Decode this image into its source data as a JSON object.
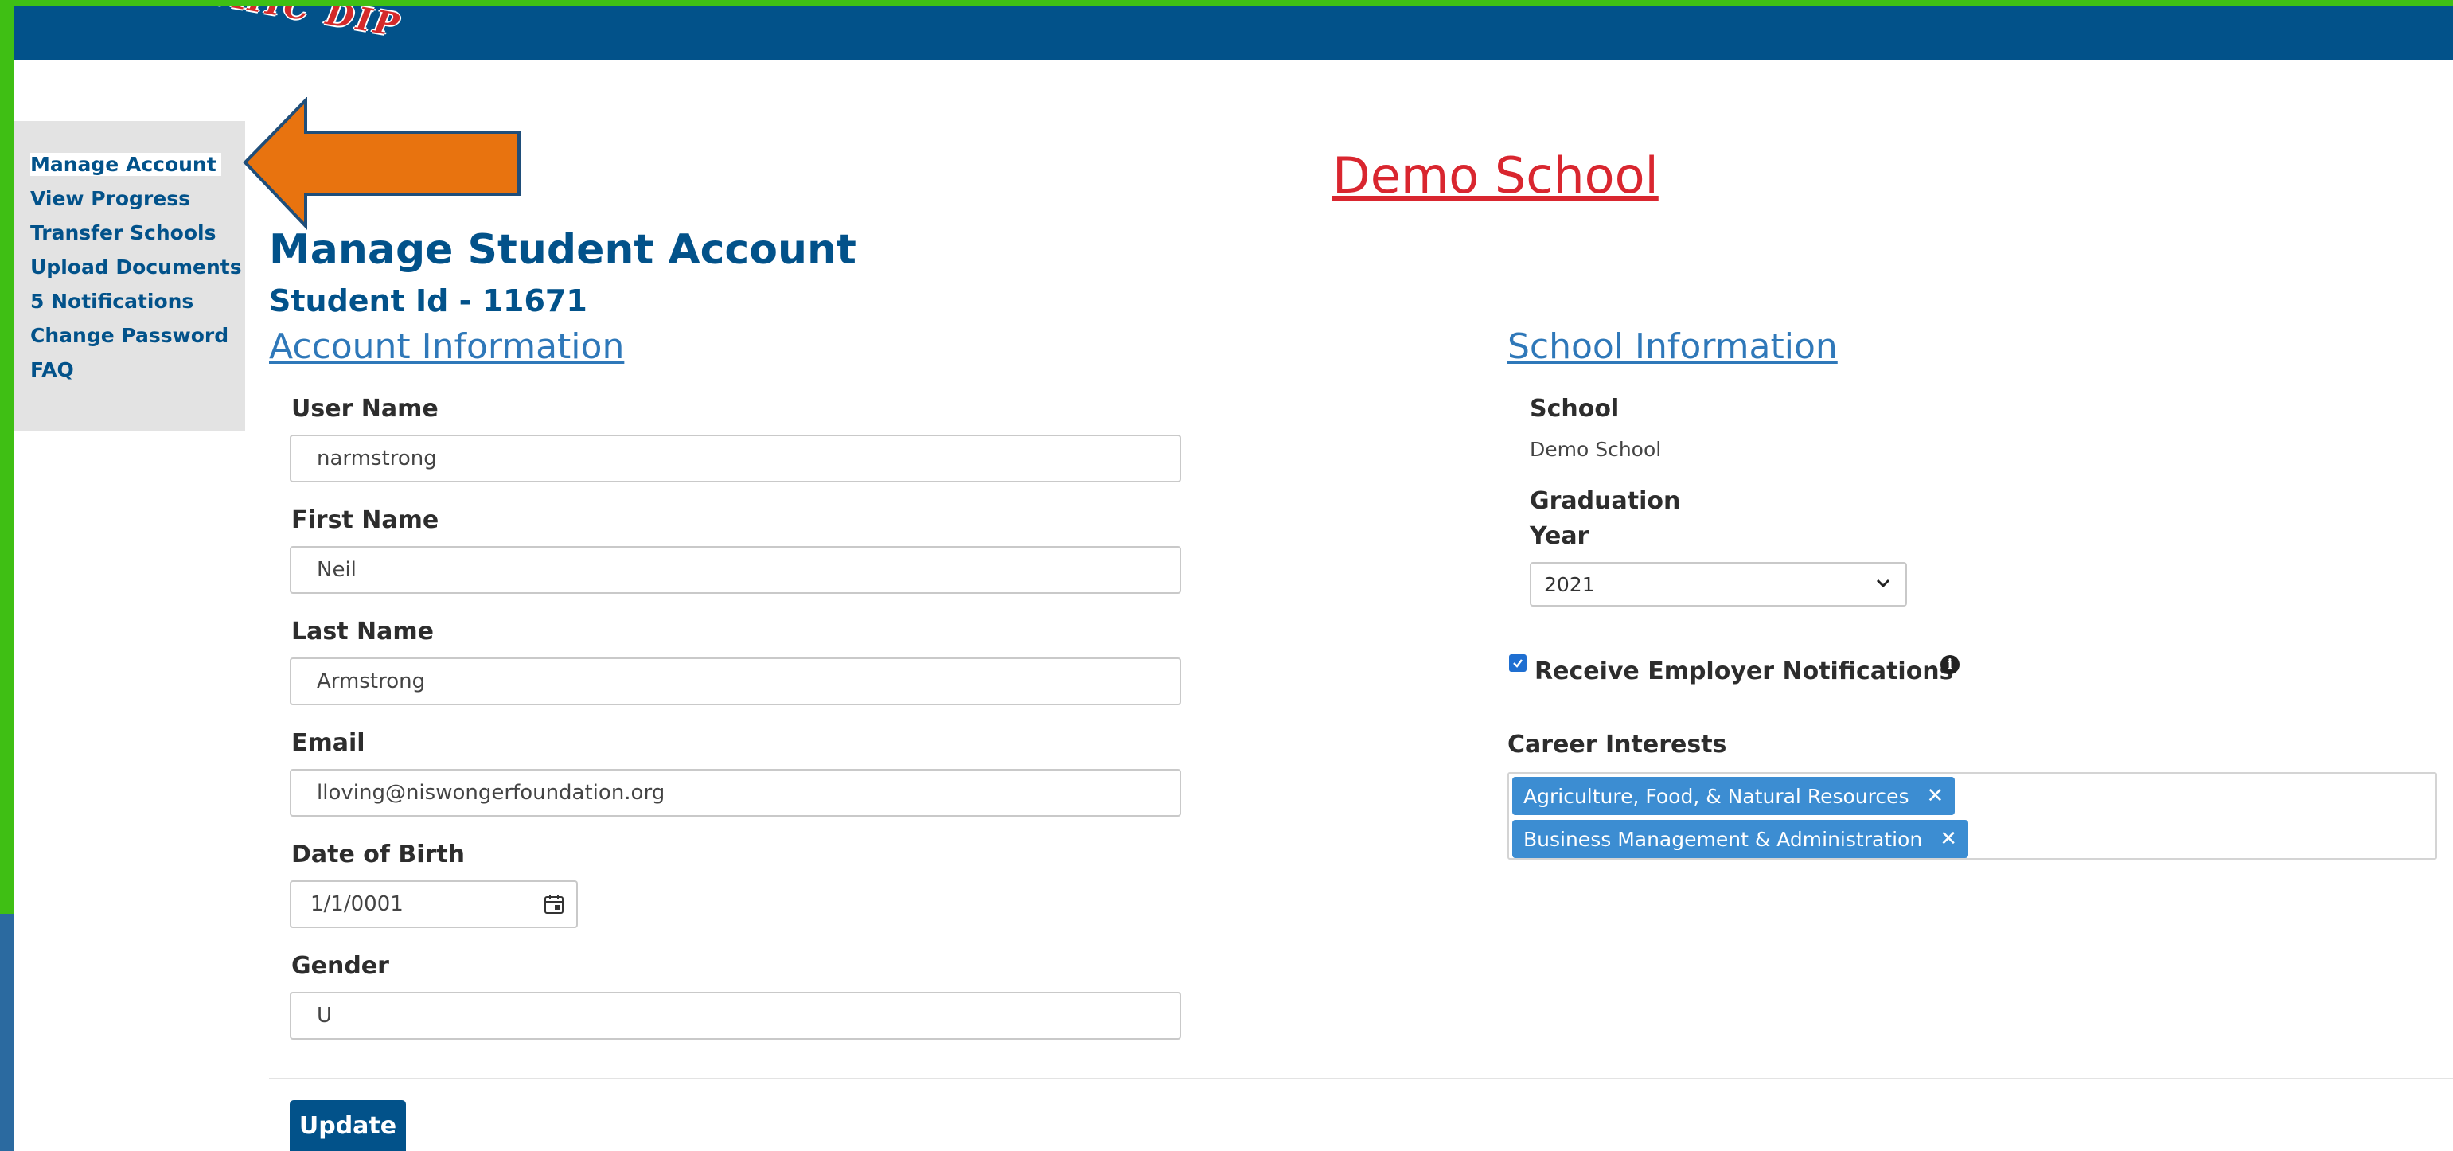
{
  "header": {
    "logo_text": "K ETHIC DIP"
  },
  "sidebar": {
    "items": [
      {
        "label": "Manage Account",
        "active": true
      },
      {
        "label": "View Progress"
      },
      {
        "label": "Transfer Schools"
      },
      {
        "label": "Upload Documents"
      },
      {
        "label": "5 Notifications"
      },
      {
        "label": "Change Password"
      },
      {
        "label": "FAQ"
      }
    ]
  },
  "school_title": "Demo School",
  "page": {
    "heading": "Manage Student Account",
    "student_id": "Student Id - 11671"
  },
  "account_info": {
    "section_title": "Account Information",
    "username_label": "User Name",
    "username_value": "narmstrong",
    "first_name_label": "First Name",
    "first_name_value": "Neil",
    "last_name_label": "Last Name",
    "last_name_value": "Armstrong",
    "email_label": "Email",
    "email_value": "lloving@niswongerfoundation.org",
    "dob_label": "Date of Birth",
    "dob_value": "1/1/0001",
    "gender_label": "Gender",
    "gender_value": "U"
  },
  "school_info": {
    "section_title": "School Information",
    "school_label": "School",
    "school_value": "Demo School",
    "grad_label_line1": "Graduation",
    "grad_label_line2": "Year",
    "grad_year_value": "2021",
    "employer_notifications_label": "Receive Employer Notifications",
    "employer_notifications_checked": true,
    "career_interests_label": "Career Interests",
    "career_interests": [
      "Agriculture, Food, & Natural Resources",
      "Business Management & Administration"
    ]
  },
  "actions": {
    "update_label": "Update"
  },
  "colors": {
    "frame_green": "#3fbf14",
    "brand_blue": "#02528a",
    "link_blue": "#2f78b9",
    "title_red": "#d9262f",
    "tag_blue": "#3c8dd2",
    "callout_orange": "#e8730f"
  },
  "icons": {
    "callout": "arrow-left-icon",
    "calendar": "calendar-icon",
    "dropdown": "chevron-down-icon",
    "info": "info-circle-icon",
    "tag_remove": "close-icon",
    "checkbox": "check-icon"
  }
}
